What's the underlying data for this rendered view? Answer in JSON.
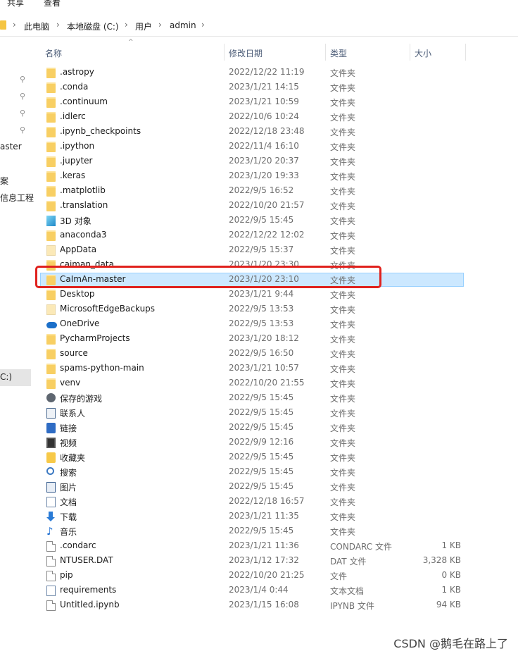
{
  "ribbon": {
    "tabs": [
      "共享",
      "查看"
    ]
  },
  "breadcrumb": [
    "此电脑",
    "本地磁盘 (C:)",
    "用户",
    "admin"
  ],
  "columns": {
    "name": "名称",
    "date": "修改日期",
    "type": "类型",
    "size": "大小"
  },
  "nav": {
    "items": [
      "aster",
      "案",
      "信息工程",
      "C:)"
    ]
  },
  "rows": [
    {
      "name": ".astropy",
      "date": "2022/12/22 11:19",
      "type": "文件夹",
      "size": "",
      "icon": "folder-icon"
    },
    {
      "name": ".conda",
      "date": "2023/1/21 14:15",
      "type": "文件夹",
      "size": "",
      "icon": "folder-icon"
    },
    {
      "name": ".continuum",
      "date": "2023/1/21 10:59",
      "type": "文件夹",
      "size": "",
      "icon": "folder-icon"
    },
    {
      "name": ".idlerc",
      "date": "2022/10/6 10:24",
      "type": "文件夹",
      "size": "",
      "icon": "folder-icon"
    },
    {
      "name": ".ipynb_checkpoints",
      "date": "2022/12/18 23:48",
      "type": "文件夹",
      "size": "",
      "icon": "folder-icon"
    },
    {
      "name": ".ipython",
      "date": "2022/11/4 16:10",
      "type": "文件夹",
      "size": "",
      "icon": "folder-icon"
    },
    {
      "name": ".jupyter",
      "date": "2023/1/20 20:37",
      "type": "文件夹",
      "size": "",
      "icon": "folder-icon"
    },
    {
      "name": ".keras",
      "date": "2023/1/20 19:33",
      "type": "文件夹",
      "size": "",
      "icon": "folder-icon"
    },
    {
      "name": ".matplotlib",
      "date": "2022/9/5 16:52",
      "type": "文件夹",
      "size": "",
      "icon": "folder-icon"
    },
    {
      "name": ".translation",
      "date": "2022/10/20 21:57",
      "type": "文件夹",
      "size": "",
      "icon": "folder-icon"
    },
    {
      "name": "3D 对象",
      "date": "2022/9/5 15:45",
      "type": "文件夹",
      "size": "",
      "icon": "3d-objects-icon"
    },
    {
      "name": "anaconda3",
      "date": "2022/12/22 12:02",
      "type": "文件夹",
      "size": "",
      "icon": "folder-icon"
    },
    {
      "name": "AppData",
      "date": "2022/9/5 15:37",
      "type": "文件夹",
      "size": "",
      "icon": "hidden-folder-icon"
    },
    {
      "name": "caiman_data",
      "date": "2023/1/20 23:30",
      "type": "文件夹",
      "size": "",
      "icon": "folder-icon"
    },
    {
      "name": "CaImAn-master",
      "date": "2023/1/20 23:10",
      "type": "文件夹",
      "size": "",
      "icon": "folder-icon",
      "selected": true
    },
    {
      "name": "Desktop",
      "date": "2023/1/21 9:44",
      "type": "文件夹",
      "size": "",
      "icon": "folder-icon"
    },
    {
      "name": "MicrosoftEdgeBackups",
      "date": "2022/9/5 13:53",
      "type": "文件夹",
      "size": "",
      "icon": "hidden-folder-icon"
    },
    {
      "name": "OneDrive",
      "date": "2022/9/5 13:53",
      "type": "文件夹",
      "size": "",
      "icon": "onedrive-icon"
    },
    {
      "name": "PycharmProjects",
      "date": "2023/1/20 18:12",
      "type": "文件夹",
      "size": "",
      "icon": "folder-icon"
    },
    {
      "name": "source",
      "date": "2022/9/5 16:50",
      "type": "文件夹",
      "size": "",
      "icon": "folder-icon"
    },
    {
      "name": "spams-python-main",
      "date": "2023/1/21 10:57",
      "type": "文件夹",
      "size": "",
      "icon": "folder-icon"
    },
    {
      "name": "venv",
      "date": "2022/10/20 21:55",
      "type": "文件夹",
      "size": "",
      "icon": "folder-icon"
    },
    {
      "name": "保存的游戏",
      "date": "2022/9/5 15:45",
      "type": "文件夹",
      "size": "",
      "icon": "saved-games-icon"
    },
    {
      "name": "联系人",
      "date": "2022/9/5 15:45",
      "type": "文件夹",
      "size": "",
      "icon": "contacts-icon"
    },
    {
      "name": "链接",
      "date": "2022/9/5 15:45",
      "type": "文件夹",
      "size": "",
      "icon": "links-icon"
    },
    {
      "name": "视频",
      "date": "2022/9/9 12:16",
      "type": "文件夹",
      "size": "",
      "icon": "videos-icon"
    },
    {
      "name": "收藏夹",
      "date": "2022/9/5 15:45",
      "type": "文件夹",
      "size": "",
      "icon": "favorites-icon"
    },
    {
      "name": "搜索",
      "date": "2022/9/5 15:45",
      "type": "文件夹",
      "size": "",
      "icon": "searches-icon"
    },
    {
      "name": "图片",
      "date": "2022/9/5 15:45",
      "type": "文件夹",
      "size": "",
      "icon": "pictures-icon"
    },
    {
      "name": "文档",
      "date": "2022/12/18 16:57",
      "type": "文件夹",
      "size": "",
      "icon": "documents-icon"
    },
    {
      "name": "下载",
      "date": "2023/1/21 11:35",
      "type": "文件夹",
      "size": "",
      "icon": "downloads-icon"
    },
    {
      "name": "音乐",
      "date": "2022/9/5 15:45",
      "type": "文件夹",
      "size": "",
      "icon": "music-icon"
    },
    {
      "name": ".condarc",
      "date": "2023/1/21 11:36",
      "type": "CONDARC 文件",
      "size": "1 KB",
      "icon": "file-icon"
    },
    {
      "name": "NTUSER.DAT",
      "date": "2023/1/12 17:32",
      "type": "DAT 文件",
      "size": "3,328 KB",
      "icon": "file-icon"
    },
    {
      "name": "pip",
      "date": "2022/10/20 21:25",
      "type": "文件",
      "size": "0 KB",
      "icon": "file-icon"
    },
    {
      "name": "requirements",
      "date": "2023/1/4 0:44",
      "type": "文本文档",
      "size": "1 KB",
      "icon": "text-file-icon"
    },
    {
      "name": "Untitled.ipynb",
      "date": "2023/1/15 16:08",
      "type": "IPYNB 文件",
      "size": "94 KB",
      "icon": "file-icon"
    }
  ],
  "watermark": "CSDN @鹅毛在路上了"
}
